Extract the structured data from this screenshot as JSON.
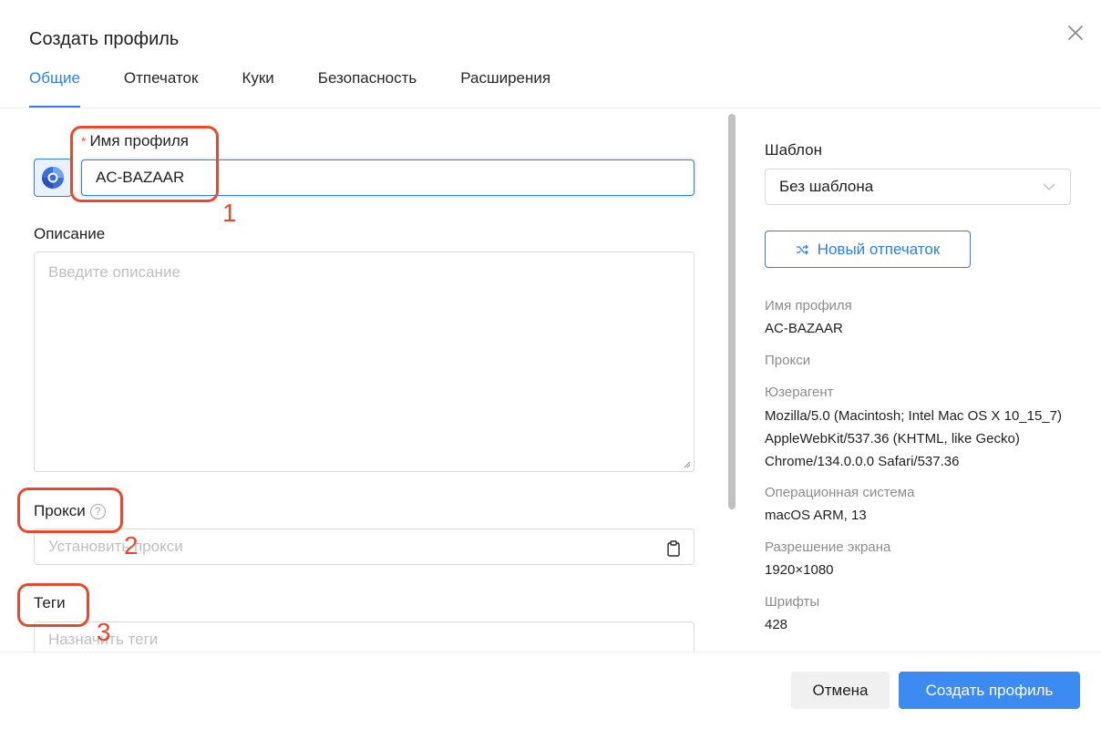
{
  "dialog": {
    "title": "Создать профиль"
  },
  "tabs": [
    {
      "label": "Общие",
      "active": true
    },
    {
      "label": "Отпечаток"
    },
    {
      "label": "Куки"
    },
    {
      "label": "Безопасность"
    },
    {
      "label": "Расширения"
    }
  ],
  "form": {
    "required_mark": "*",
    "profile_name_label": "Имя профиля",
    "profile_name_value": "AC-BAZAAR",
    "description_label": "Описание",
    "description_placeholder": "Введите описание",
    "proxy_label": "Прокси",
    "proxy_help": "?",
    "proxy_placeholder": "Установить прокси",
    "tags_label": "Теги",
    "tags_placeholder": "Назначить теги"
  },
  "side": {
    "template_label": "Шаблон",
    "template_value": "Без шаблона",
    "new_fingerprint_button": "Новый отпечаток",
    "profile_name_key": "Имя профиля",
    "profile_name_value": "AC-BAZAAR",
    "proxy_key": "Прокси",
    "useragent_key": "Юзерагент",
    "useragent_value": "Mozilla/5.0 (Macintosh; Intel Mac OS X 10_15_7) AppleWebKit/537.36 (KHTML, like Gecko) Chrome/134.0.0.0 Safari/537.36",
    "os_key": "Операционная система",
    "os_value": "macOS ARM, 13",
    "resolution_key": "Разрешение экрана",
    "resolution_value": "1920×1080",
    "fonts_key": "Шрифты",
    "fonts_value": "428"
  },
  "footer": {
    "cancel": "Отмена",
    "create": "Создать профиль"
  },
  "annotations": [
    "1",
    "2",
    "3"
  ],
  "colors": {
    "accent": "#2f7fe0",
    "primary_button": "#3b8bf2",
    "annotation": "#e64a2e",
    "required": "#ff4d4f"
  },
  "icons": [
    "close-icon",
    "browser-logo-icon",
    "shuffle-icon",
    "chevron-down-icon",
    "clipboard-icon",
    "help-icon",
    "resize-handle-icon"
  ]
}
